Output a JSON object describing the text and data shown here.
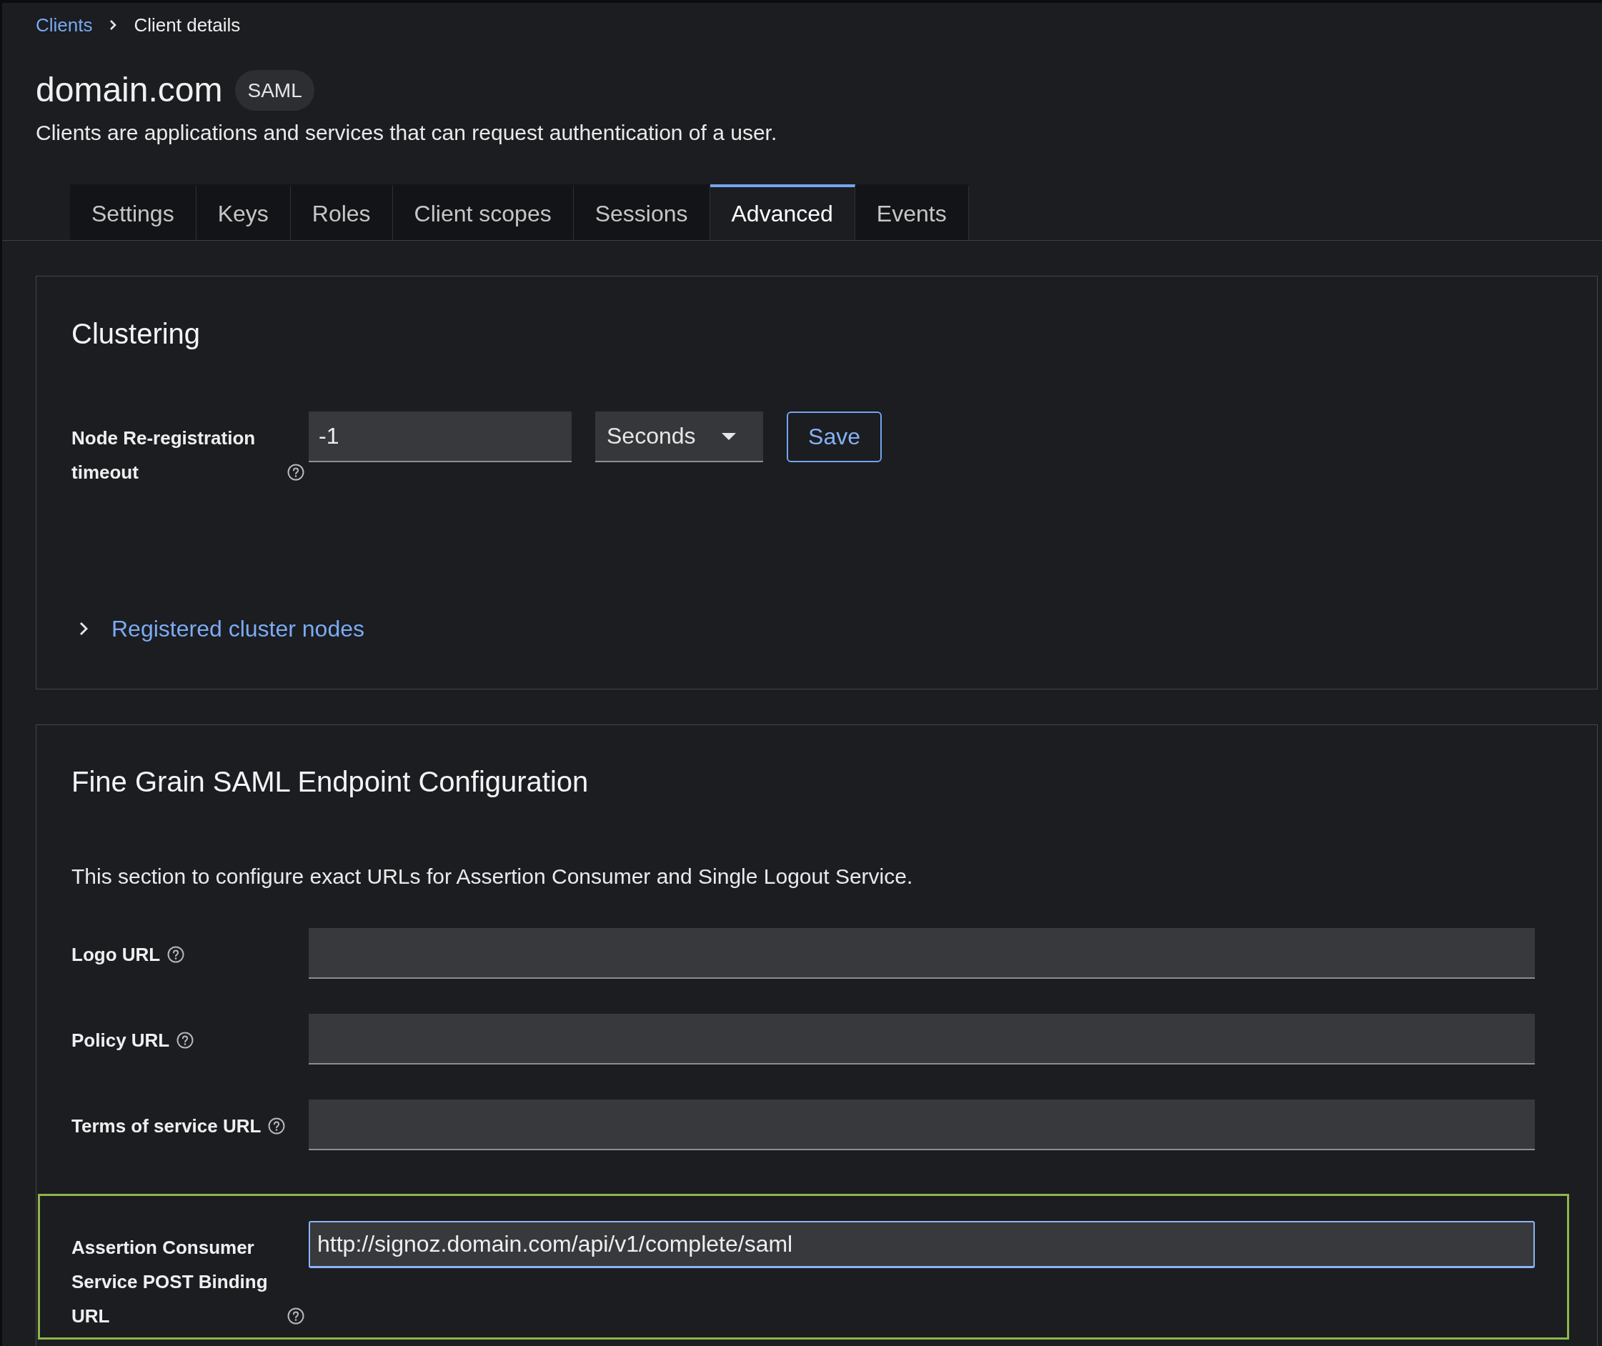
{
  "breadcrumb": [
    {
      "label": "Clients",
      "kind": "link"
    },
    {
      "label": "Client details",
      "kind": "current"
    }
  ],
  "header": {
    "title": "domain.com",
    "badge": "SAML",
    "description": "Clients are applications and services that can request authentication of a user."
  },
  "tabs": [
    {
      "label": "Settings",
      "selected": false
    },
    {
      "label": "Keys",
      "selected": false
    },
    {
      "label": "Roles",
      "selected": false
    },
    {
      "label": "Client scopes",
      "selected": false
    },
    {
      "label": "Sessions",
      "selected": false
    },
    {
      "label": "Advanced",
      "selected": true
    },
    {
      "label": "Events",
      "selected": false
    }
  ],
  "clustering": {
    "title": "Clustering",
    "timeout": {
      "label": "Node Re-registration timeout",
      "help": true,
      "value": "-1",
      "unit": "Seconds"
    },
    "save_button": "Save",
    "cluster_nodes": {
      "label": "Registered cluster nodes",
      "expanded": false
    }
  },
  "endpoint_config": {
    "title": "Fine Grain SAML Endpoint Configuration",
    "description": "This section to configure exact URLs for Assertion Consumer and Single Logout Service.",
    "fields": [
      {
        "label": "Logo URL",
        "help": true,
        "focused": false,
        "highlighted": false
      },
      {
        "label": "Policy URL",
        "help": true,
        "focused": false,
        "highlighted": false
      },
      {
        "label": "Terms of service URL",
        "help": true,
        "focused": false,
        "highlighted": false
      },
      {
        "label": "Assertion Consumer Service POST Binding URL",
        "help": true,
        "value": "http://signoz.domain.com/api/v1/complete/saml",
        "focused": true,
        "highlighted": true
      }
    ]
  }
}
